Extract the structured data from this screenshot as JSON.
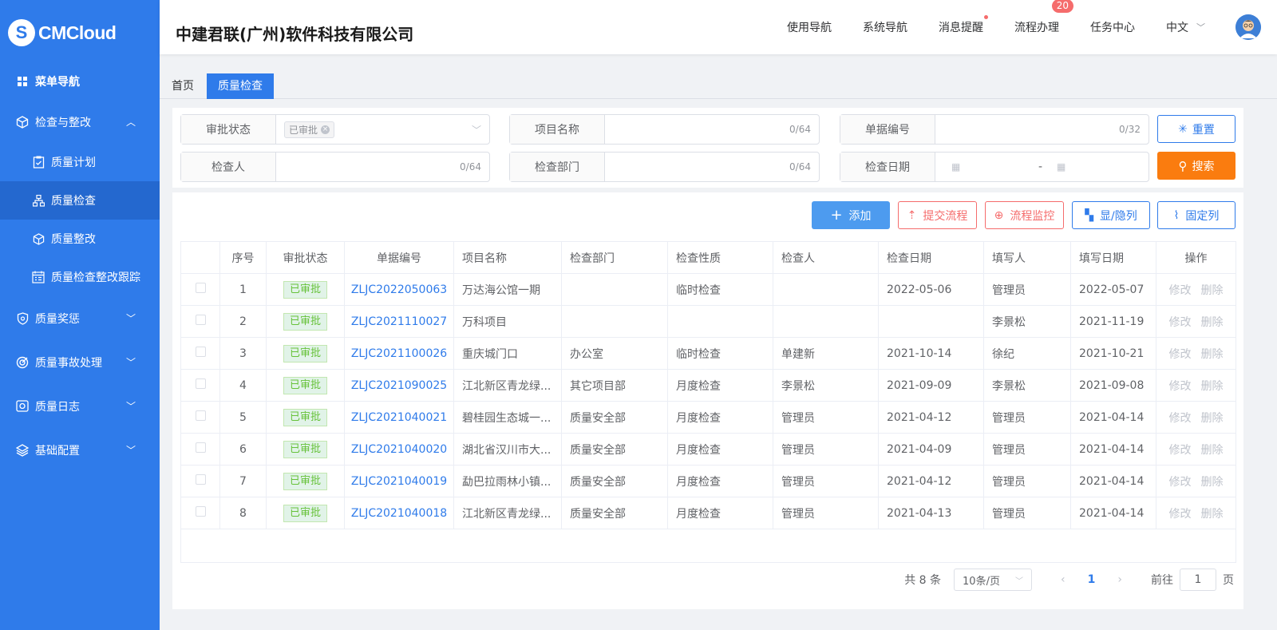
{
  "app": {
    "logo": "CMCloud",
    "company": "中建君联(广州)软件科技有限公司"
  },
  "topnav": {
    "items": [
      "使用导航",
      "系统导航",
      "消息提醒",
      "流程办理",
      "任务中心"
    ],
    "badge": "20",
    "lang": "中文"
  },
  "sidebar": {
    "items": [
      {
        "label": "菜单导航"
      },
      {
        "label": "检查与整改"
      },
      {
        "label": "质量计划"
      },
      {
        "label": "质量检查"
      },
      {
        "label": "质量整改"
      },
      {
        "label": "质量检查整改跟踪"
      },
      {
        "label": "质量奖惩"
      },
      {
        "label": "质量事故处理"
      },
      {
        "label": "质量日志"
      },
      {
        "label": "基础配置"
      }
    ]
  },
  "tabs": [
    "首页",
    "质量检查"
  ],
  "filters": {
    "status": {
      "label": "审批状态",
      "tag": "已审批"
    },
    "project": {
      "label": "项目名称",
      "count": "0/64"
    },
    "doc_no": {
      "label": "单据编号",
      "count": "0/32"
    },
    "inspector": {
      "label": "检查人",
      "count": "0/64"
    },
    "dept": {
      "label": "检查部门",
      "count": "0/64"
    },
    "date": {
      "label": "检查日期",
      "sep": "-"
    },
    "reset": "重置",
    "search": "搜索"
  },
  "toolbar": {
    "add": "添加",
    "submit": "提交流程",
    "monitor": "流程监控",
    "toggle_cols": "显/隐列",
    "fix_cols": "固定列"
  },
  "table": {
    "headers": [
      "序号",
      "审批状态",
      "单据编号",
      "项目名称",
      "检查部门",
      "检查性质",
      "检查人",
      "检查日期",
      "填写人",
      "填写日期",
      "操作"
    ],
    "rows": [
      {
        "no": "1",
        "status": "已审批",
        "doc": "ZLJC2022050063",
        "project": "万达海公馆一期",
        "dept": "",
        "nature": "临时检查",
        "inspector": "",
        "date": "2022-05-06",
        "writer": "管理员",
        "wdate": "2022-05-07"
      },
      {
        "no": "2",
        "status": "已审批",
        "doc": "ZLJC2021110027",
        "project": "万科项目",
        "dept": "",
        "nature": "",
        "inspector": "",
        "date": "",
        "writer": "李景松",
        "wdate": "2021-11-19"
      },
      {
        "no": "3",
        "status": "已审批",
        "doc": "ZLJC2021100026",
        "project": "重庆城门口",
        "dept": "办公室",
        "nature": "临时检查",
        "inspector": "单建新",
        "date": "2021-10-14",
        "writer": "徐纪",
        "wdate": "2021-10-21"
      },
      {
        "no": "4",
        "status": "已审批",
        "doc": "ZLJC2021090025",
        "project": "江北新区青龙绿...",
        "dept": "其它项目部",
        "nature": "月度检查",
        "inspector": "李景松",
        "date": "2021-09-09",
        "writer": "李景松",
        "wdate": "2021-09-08"
      },
      {
        "no": "5",
        "status": "已审批",
        "doc": "ZLJC2021040021",
        "project": "碧桂园生态城一...",
        "dept": "质量安全部",
        "nature": "月度检查",
        "inspector": "管理员",
        "date": "2021-04-12",
        "writer": "管理员",
        "wdate": "2021-04-14"
      },
      {
        "no": "6",
        "status": "已审批",
        "doc": "ZLJC2021040020",
        "project": "湖北省汉川市大...",
        "dept": "质量安全部",
        "nature": "月度检查",
        "inspector": "管理员",
        "date": "2021-04-09",
        "writer": "管理员",
        "wdate": "2021-04-14"
      },
      {
        "no": "7",
        "status": "已审批",
        "doc": "ZLJC2021040019",
        "project": "勐巴拉雨林小镇...",
        "dept": "质量安全部",
        "nature": "月度检查",
        "inspector": "管理员",
        "date": "2021-04-12",
        "writer": "管理员",
        "wdate": "2021-04-14"
      },
      {
        "no": "8",
        "status": "已审批",
        "doc": "ZLJC2021040018",
        "project": "江北新区青龙绿...",
        "dept": "质量安全部",
        "nature": "月度检查",
        "inspector": "管理员",
        "date": "2021-04-13",
        "writer": "管理员",
        "wdate": "2021-04-14"
      }
    ],
    "op_edit": "修改",
    "op_delete": "删除"
  },
  "pager": {
    "total": "共 8 条",
    "size": "10条/页",
    "current": "1",
    "goto": "前往",
    "page_input": "1",
    "page_suffix": "页"
  },
  "colors": {
    "sidebar": "#2f7bea",
    "accent": "#2f7bea",
    "search": "#fa7c0f",
    "danger": "#f56c6c",
    "success": "#67c23a"
  }
}
